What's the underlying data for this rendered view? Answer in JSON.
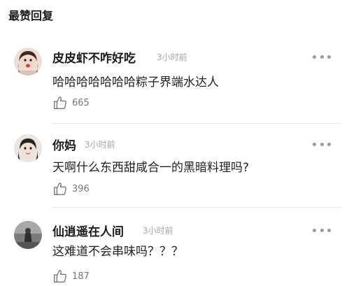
{
  "section": {
    "title": "最赞回复"
  },
  "comments": [
    {
      "username": "皮皮虾不咋好吃",
      "time": "3小时前",
      "text": "哈哈哈哈哈哈哈粽子界端水达人",
      "likes": "665",
      "avatar_icon": "user-avatar-girl-icon",
      "more_icon": "more-dots-icon",
      "like_icon": "thumbs-up-icon"
    },
    {
      "username": "你妈",
      "time": "3小时前",
      "text": "天啊什么东西甜咸合一的黑暗料理吗?",
      "likes": "396",
      "avatar_icon": "user-avatar-girl-icon",
      "more_icon": "more-dots-icon",
      "like_icon": "thumbs-up-icon"
    },
    {
      "username": "仙逍遥在人间",
      "time": "3小时前",
      "text": "这难道不会串味吗？？？",
      "likes": "187",
      "avatar_icon": "user-avatar-photo-icon",
      "more_icon": "more-dots-icon",
      "like_icon": "thumbs-up-icon"
    }
  ],
  "colors": {
    "name": "#1a1a1a",
    "time": "#a3a3a3",
    "count": "#777777",
    "divider": "#e8e8e8"
  }
}
